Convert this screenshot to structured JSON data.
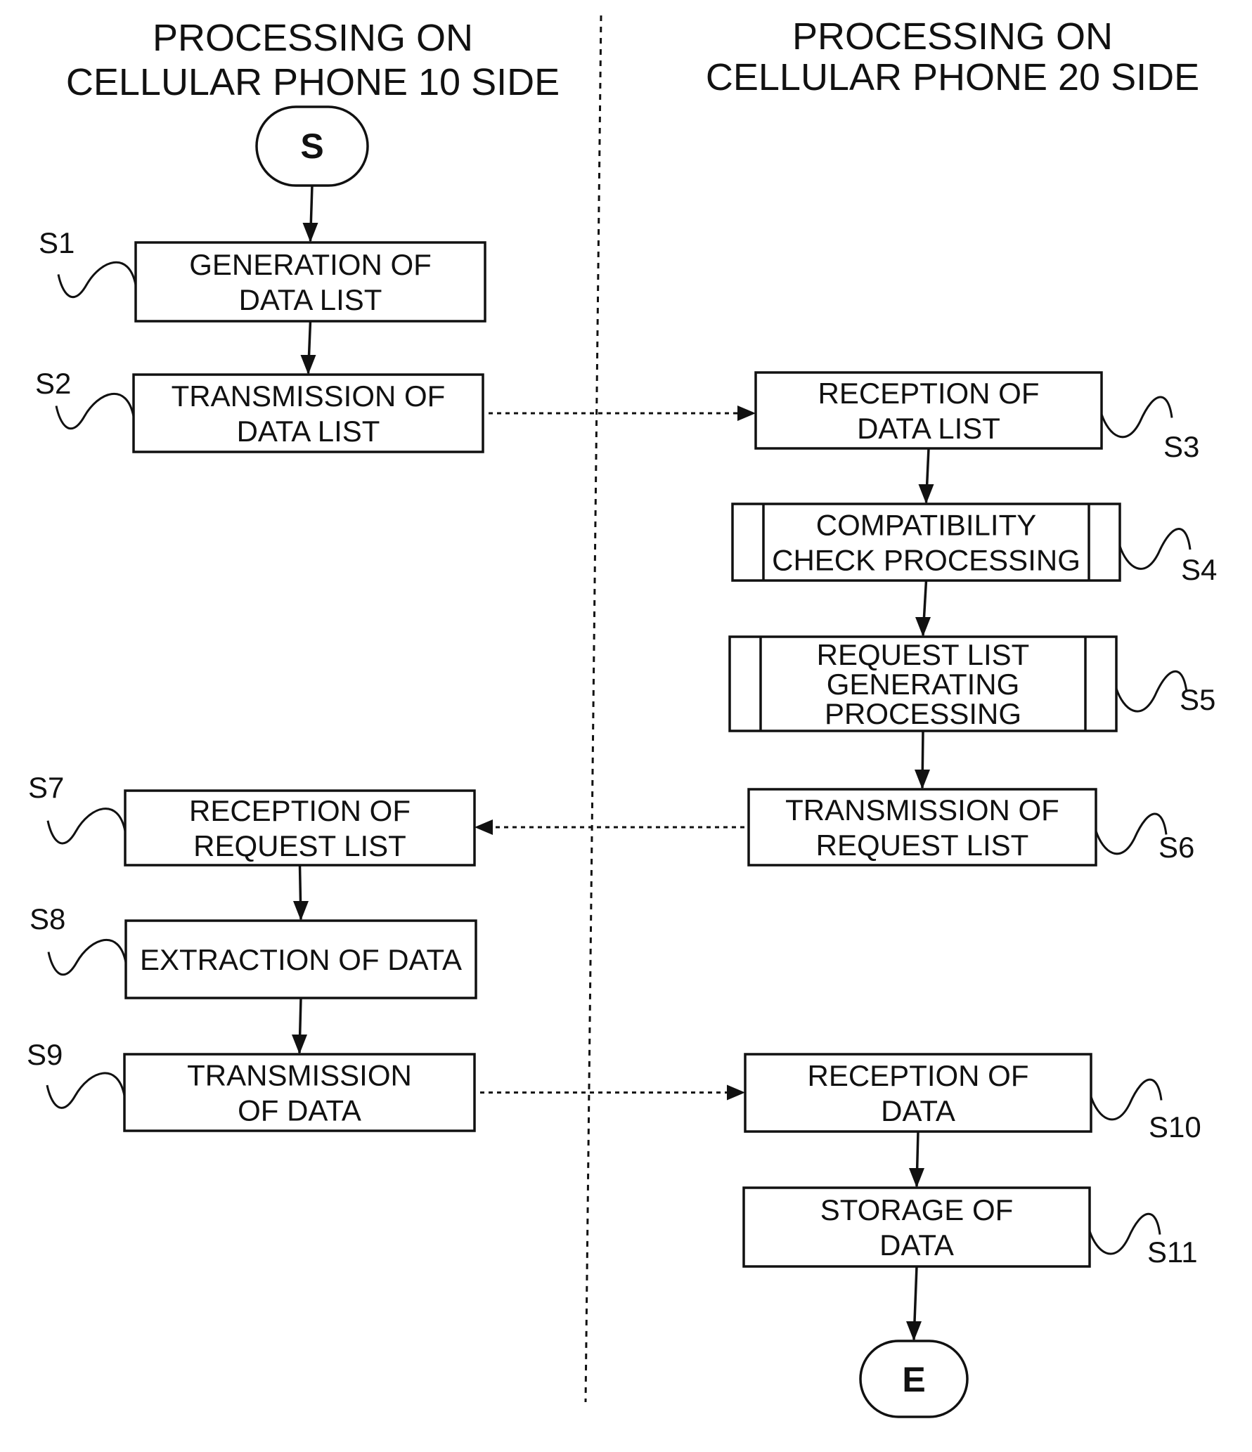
{
  "lanes": {
    "left": {
      "title_line1": "PROCESSING ON",
      "title_line2": "CELLULAR PHONE 10 SIDE"
    },
    "right": {
      "title_line1": "PROCESSING ON",
      "title_line2": "CELLULAR PHONE 20 SIDE"
    }
  },
  "terminals": {
    "start": {
      "label": "S"
    },
    "end": {
      "label": "E"
    }
  },
  "steps": [
    {
      "id": "S1",
      "lane": "left",
      "lines": [
        "GENERATION OF",
        "DATA LIST"
      ],
      "type": "process"
    },
    {
      "id": "S2",
      "lane": "left",
      "lines": [
        "TRANSMISSION OF",
        "DATA LIST"
      ],
      "type": "process"
    },
    {
      "id": "S3",
      "lane": "right",
      "lines": [
        "RECEPTION OF",
        "DATA LIST"
      ],
      "type": "process"
    },
    {
      "id": "S4",
      "lane": "right",
      "lines": [
        "COMPATIBILITY",
        "CHECK PROCESSING"
      ],
      "type": "predefined-process"
    },
    {
      "id": "S5",
      "lane": "right",
      "lines": [
        "REQUEST LIST",
        "GENERATING",
        "PROCESSING"
      ],
      "type": "predefined-process"
    },
    {
      "id": "S6",
      "lane": "right",
      "lines": [
        "TRANSMISSION OF",
        "REQUEST LIST"
      ],
      "type": "process"
    },
    {
      "id": "S7",
      "lane": "left",
      "lines": [
        "RECEPTION OF",
        "REQUEST LIST"
      ],
      "type": "process"
    },
    {
      "id": "S8",
      "lane": "left",
      "lines": [
        "EXTRACTION OF DATA"
      ],
      "type": "process"
    },
    {
      "id": "S9",
      "lane": "left",
      "lines": [
        "TRANSMISSION",
        "OF DATA"
      ],
      "type": "process"
    },
    {
      "id": "S10",
      "lane": "right",
      "lines": [
        "RECEPTION OF",
        "DATA"
      ],
      "type": "process"
    },
    {
      "id": "S11",
      "lane": "right",
      "lines": [
        "STORAGE OF",
        "DATA"
      ],
      "type": "process"
    }
  ],
  "flows": [
    {
      "from": "S",
      "to": "S1",
      "style": "solid"
    },
    {
      "from": "S1",
      "to": "S2",
      "style": "solid"
    },
    {
      "from": "S2",
      "to": "S3",
      "style": "dashed"
    },
    {
      "from": "S3",
      "to": "S4",
      "style": "solid"
    },
    {
      "from": "S4",
      "to": "S5",
      "style": "solid"
    },
    {
      "from": "S5",
      "to": "S6",
      "style": "solid"
    },
    {
      "from": "S6",
      "to": "S7",
      "style": "dashed"
    },
    {
      "from": "S7",
      "to": "S8",
      "style": "solid"
    },
    {
      "from": "S8",
      "to": "S9",
      "style": "solid"
    },
    {
      "from": "S9",
      "to": "S10",
      "style": "dashed"
    },
    {
      "from": "S10",
      "to": "S11",
      "style": "solid"
    },
    {
      "from": "S11",
      "to": "E",
      "style": "solid"
    }
  ]
}
